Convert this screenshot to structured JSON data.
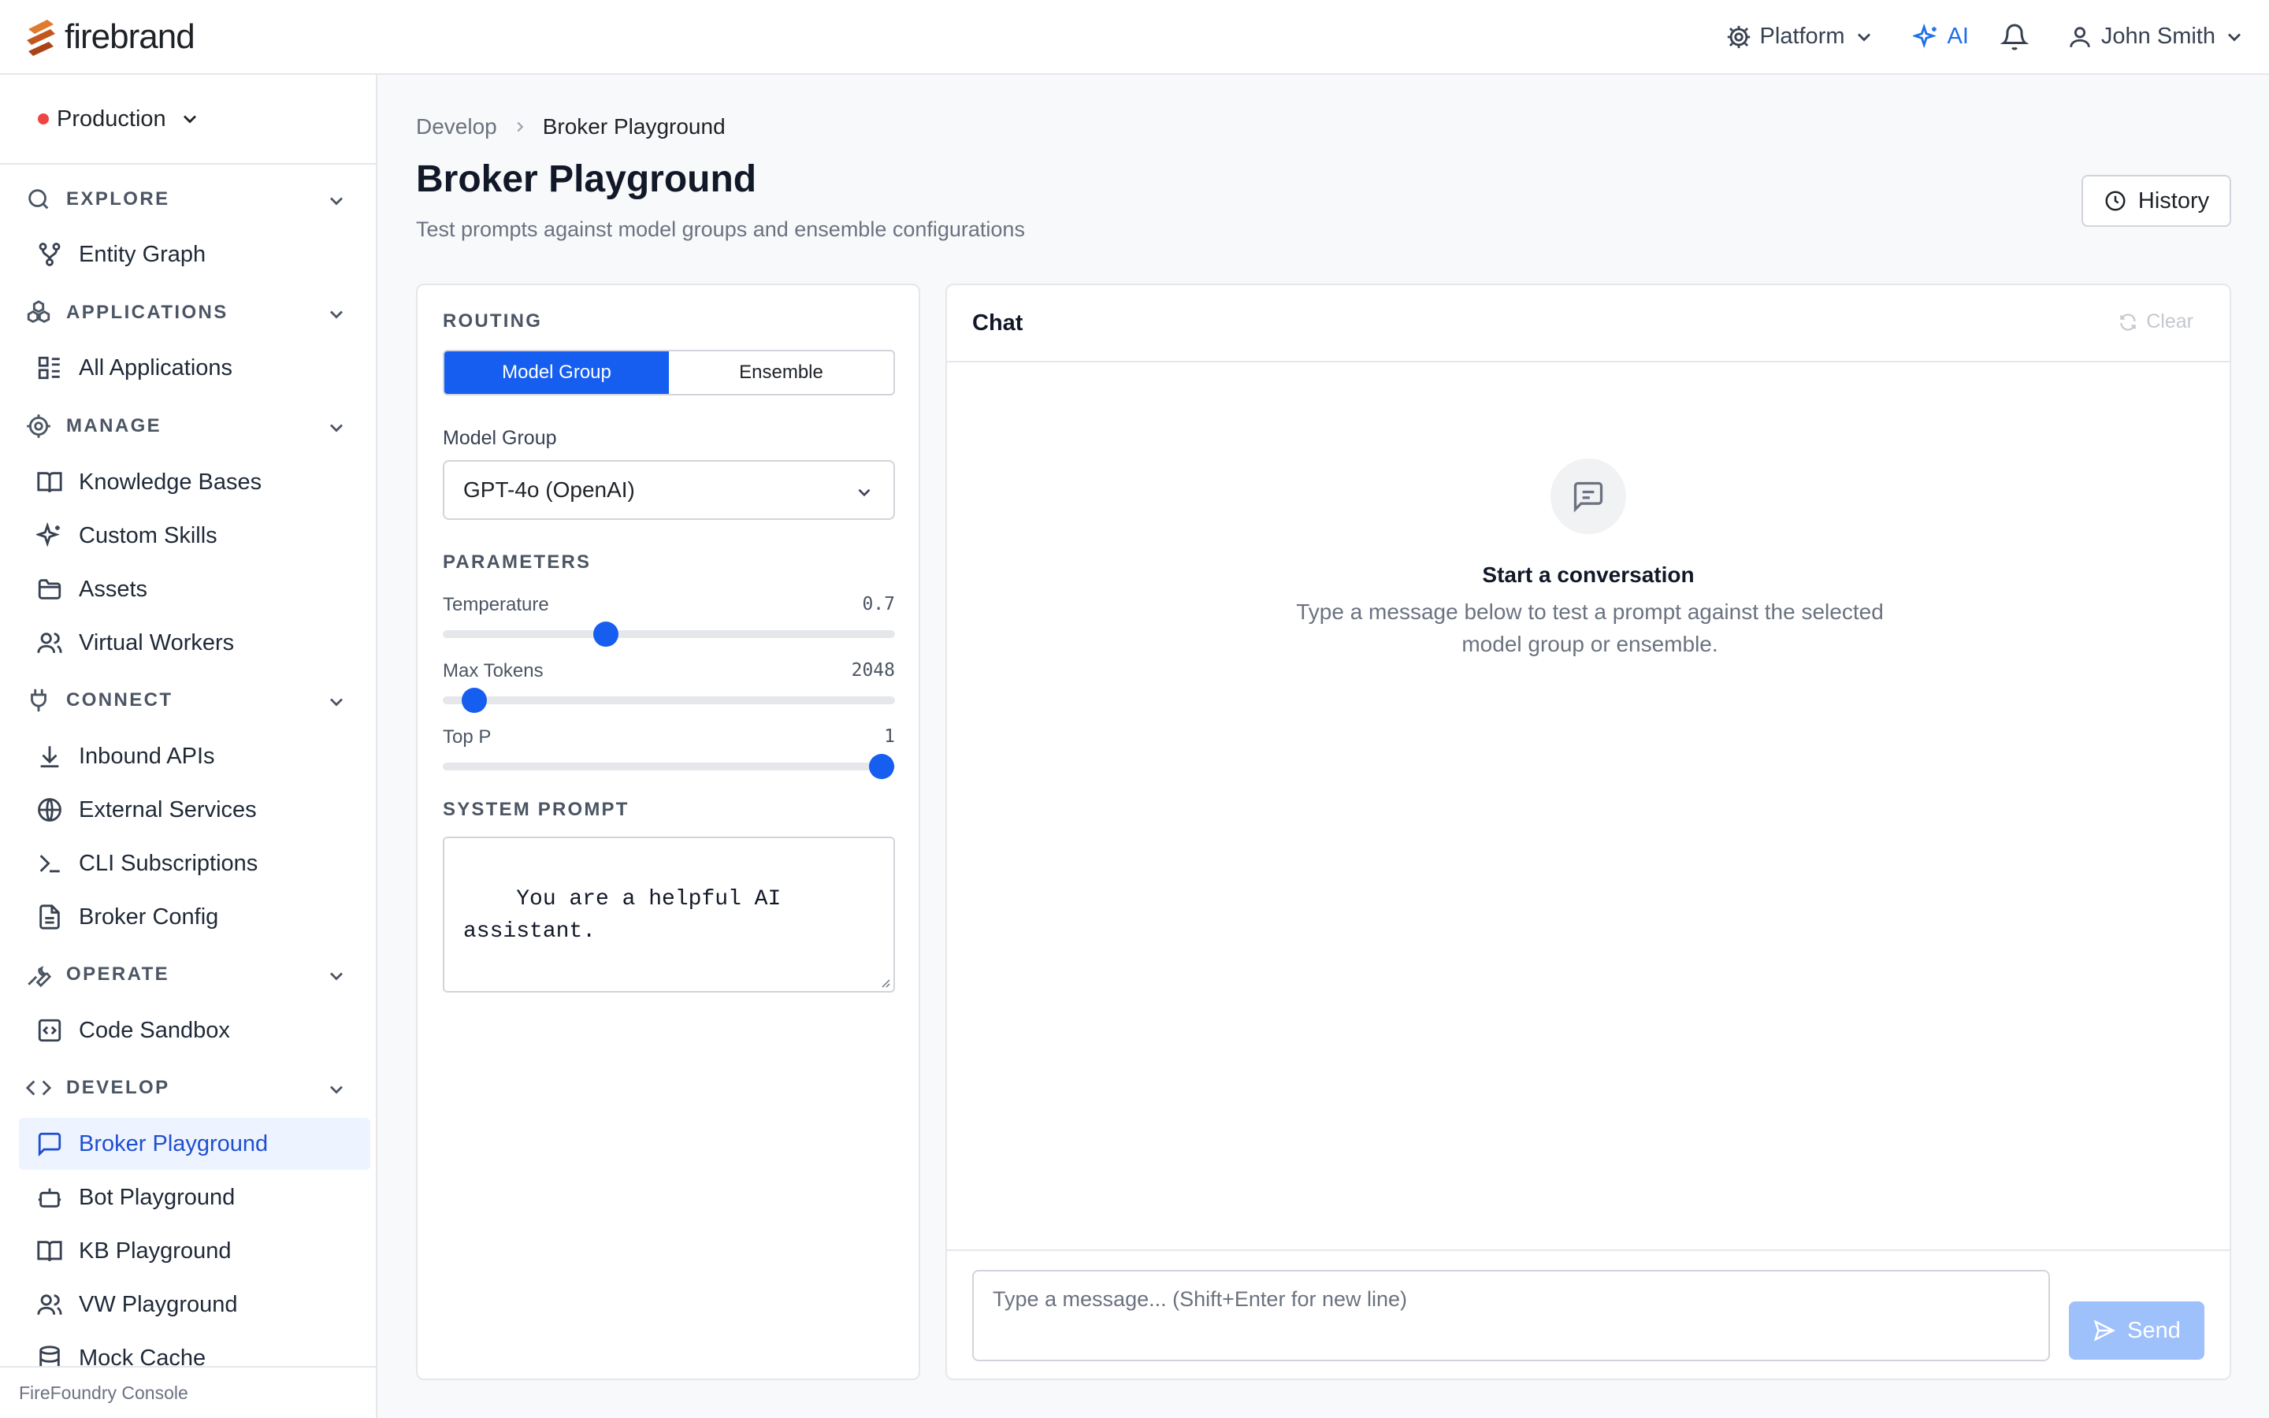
{
  "brand": {
    "name": "firebrand"
  },
  "topbar": {
    "platform_label": "Platform",
    "ai_label": "AI",
    "user_name": "John Smith"
  },
  "sidebar": {
    "environment": "Production",
    "sections": [
      {
        "label": "EXPLORE",
        "icon": "search-icon",
        "items": [
          {
            "label": "Entity Graph",
            "icon": "graph-icon"
          }
        ]
      },
      {
        "label": "APPLICATIONS",
        "icon": "cubes-icon",
        "items": [
          {
            "label": "All Applications",
            "icon": "grid-list-icon"
          }
        ]
      },
      {
        "label": "MANAGE",
        "icon": "gear-icon",
        "items": [
          {
            "label": "Knowledge Bases",
            "icon": "book-icon"
          },
          {
            "label": "Custom Skills",
            "icon": "sparkles-icon"
          },
          {
            "label": "Assets",
            "icon": "folder-icon"
          },
          {
            "label": "Virtual Workers",
            "icon": "users-icon"
          }
        ]
      },
      {
        "label": "CONNECT",
        "icon": "plug-icon",
        "items": [
          {
            "label": "Inbound APIs",
            "icon": "download-icon"
          },
          {
            "label": "External Services",
            "icon": "globe-icon"
          },
          {
            "label": "CLI Subscriptions",
            "icon": "terminal-icon"
          },
          {
            "label": "Broker Config",
            "icon": "file-text-icon"
          }
        ]
      },
      {
        "label": "OPERATE",
        "icon": "wrench-icon",
        "items": [
          {
            "label": "Code Sandbox",
            "icon": "code-square-icon"
          }
        ]
      },
      {
        "label": "DEVELOP",
        "icon": "code-icon",
        "items": [
          {
            "label": "Broker Playground",
            "icon": "message-square-icon",
            "active": true
          },
          {
            "label": "Bot Playground",
            "icon": "bot-icon"
          },
          {
            "label": "KB Playground",
            "icon": "book-icon"
          },
          {
            "label": "VW Playground",
            "icon": "users-icon"
          },
          {
            "label": "Mock Cache",
            "icon": "database-icon"
          }
        ]
      }
    ],
    "footer": "FireFoundry Console"
  },
  "breadcrumb": {
    "parent": "Develop",
    "current": "Broker Playground"
  },
  "page": {
    "title": "Broker Playground",
    "subtitle": "Test prompts against model groups and ensemble configurations",
    "history_label": "History"
  },
  "config": {
    "routing_label": "ROUTING",
    "routing_options": [
      "Model Group",
      "Ensemble"
    ],
    "routing_selected": "Model Group",
    "model_group_label": "Model Group",
    "model_group_value": "GPT-4o (OpenAI)",
    "parameters_label": "PARAMETERS",
    "temperature": {
      "label": "Temperature",
      "value": "0.7",
      "fraction": 0.36
    },
    "max_tokens": {
      "label": "Max Tokens",
      "value": "2048",
      "fraction": 0.07
    },
    "top_p": {
      "label": "Top P",
      "value": "1",
      "fraction": 0.97
    },
    "system_prompt_label": "SYSTEM PROMPT",
    "system_prompt": "You are a helpful AI\nassistant."
  },
  "chat": {
    "title": "Chat",
    "clear_label": "Clear",
    "empty_title": "Start a conversation",
    "empty_desc": "Type a message below to test a prompt against the selected model group or ensemble.",
    "input_placeholder": "Type a message... (Shift+Enter for new line)",
    "send_label": "Send"
  },
  "colors": {
    "accent": "#155eef",
    "env_dot": "#ef4444",
    "send_disabled": "#9ec0fb"
  }
}
